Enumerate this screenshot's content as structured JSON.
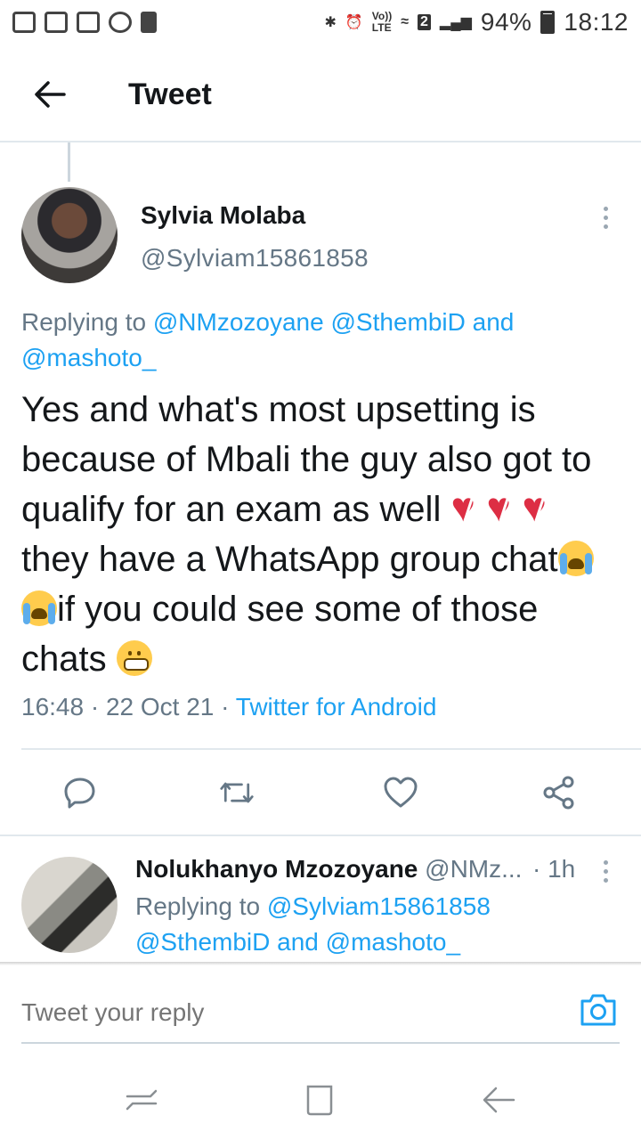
{
  "status_bar": {
    "vol_label": "Vo))",
    "lte_label": "LTE",
    "sim_label": "2",
    "battery": "94%",
    "time": "18:12"
  },
  "app_bar": {
    "title": "Tweet"
  },
  "tweet": {
    "author_name": "Sylvia Molaba",
    "author_handle": "@Sylviam15861858",
    "replying_prefix": "Replying to",
    "replying_to": [
      "@NMzozoyane",
      "@SthembiD"
    ],
    "replying_and": "and",
    "replying_last": "@mashoto_",
    "body_part1": "Yes and what's most upsetting is because of Mbali the guy also got to qualify for an exam as well ",
    "body_part2": " they have a WhatsApp group chat",
    "body_part3": "if you could see some of those chats ",
    "time": "16:48",
    "date": "22 Oct 21",
    "source": "Twitter for Android",
    "meta_sep": " · "
  },
  "actions": [
    "reply-icon",
    "retweet-icon",
    "like-icon",
    "share-icon"
  ],
  "reply_tweet": {
    "author_name": "Nolukhanyo Mzozoyane",
    "author_handle": "@NMz...",
    "time": "· 1h",
    "replying_prefix": "Replying to",
    "replying_to1": "@Sylviam15861858",
    "replying_to2": "@SthembiD",
    "replying_and": "and",
    "replying_last": "@mashoto_"
  },
  "compose": {
    "placeholder": "Tweet your reply"
  },
  "colors": {
    "link": "#1da1f2",
    "muted": "#657786",
    "text": "#14171a"
  }
}
